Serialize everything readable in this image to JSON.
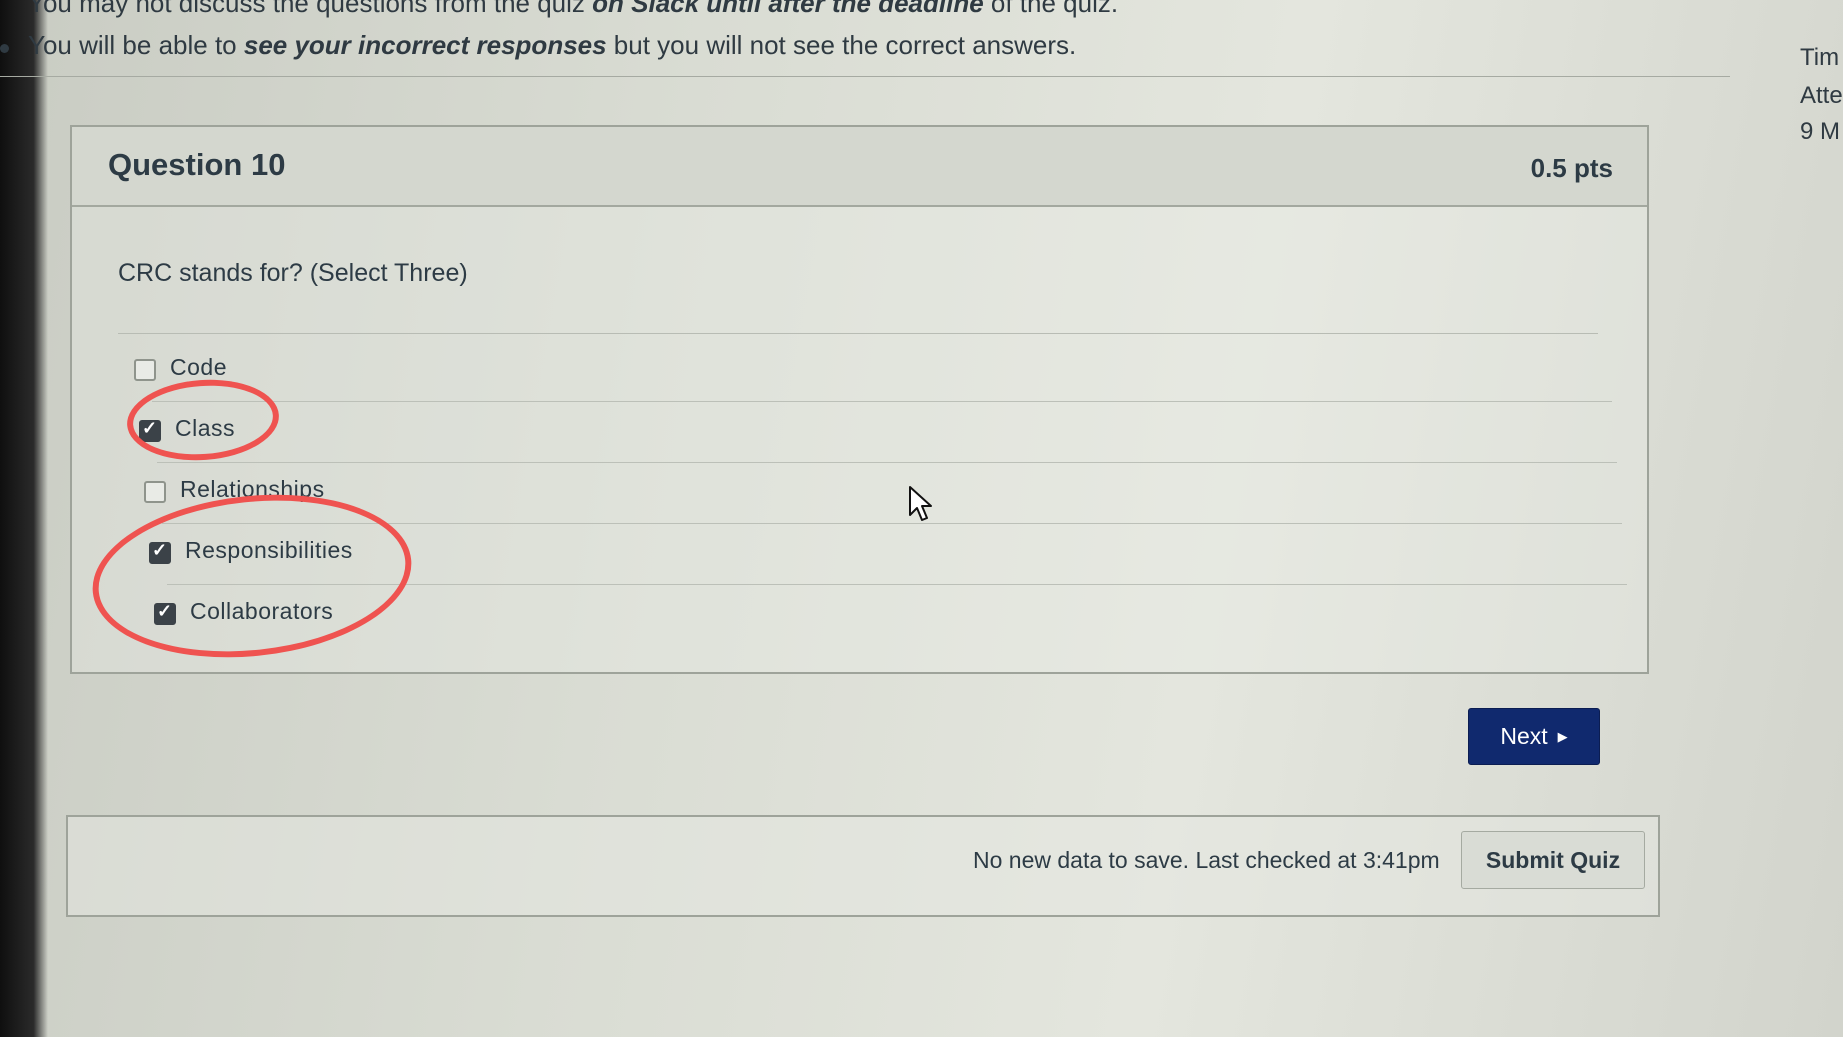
{
  "notices": {
    "line1_a": "You may not discuss the questions from the quiz ",
    "line1_b": "on Slack until after the deadline",
    "line1_c": " of the quiz.",
    "line2_a": "You will be able to ",
    "line2_b": "see your incorrect responses",
    "line2_c": " but you will not see the correct answers."
  },
  "side_info": {
    "line1": "Tim",
    "line2": "Atte",
    "line3": "9 M"
  },
  "question": {
    "title": "Question 10",
    "points": "0.5 pts",
    "text": "CRC stands for? (Select Three)",
    "answers": [
      {
        "label": "Code",
        "checked": false
      },
      {
        "label": "Class",
        "checked": true
      },
      {
        "label": "Relationships",
        "checked": false
      },
      {
        "label": "Responsibilities",
        "checked": true
      },
      {
        "label": "Collaborators",
        "checked": true
      }
    ]
  },
  "nav": {
    "next_label": "Next"
  },
  "footer": {
    "status": "No new data to save. Last checked at 3:41pm",
    "submit_label": "Submit Quiz"
  },
  "annotation_color": "#ef5350",
  "primary_button_color": "#10296e"
}
